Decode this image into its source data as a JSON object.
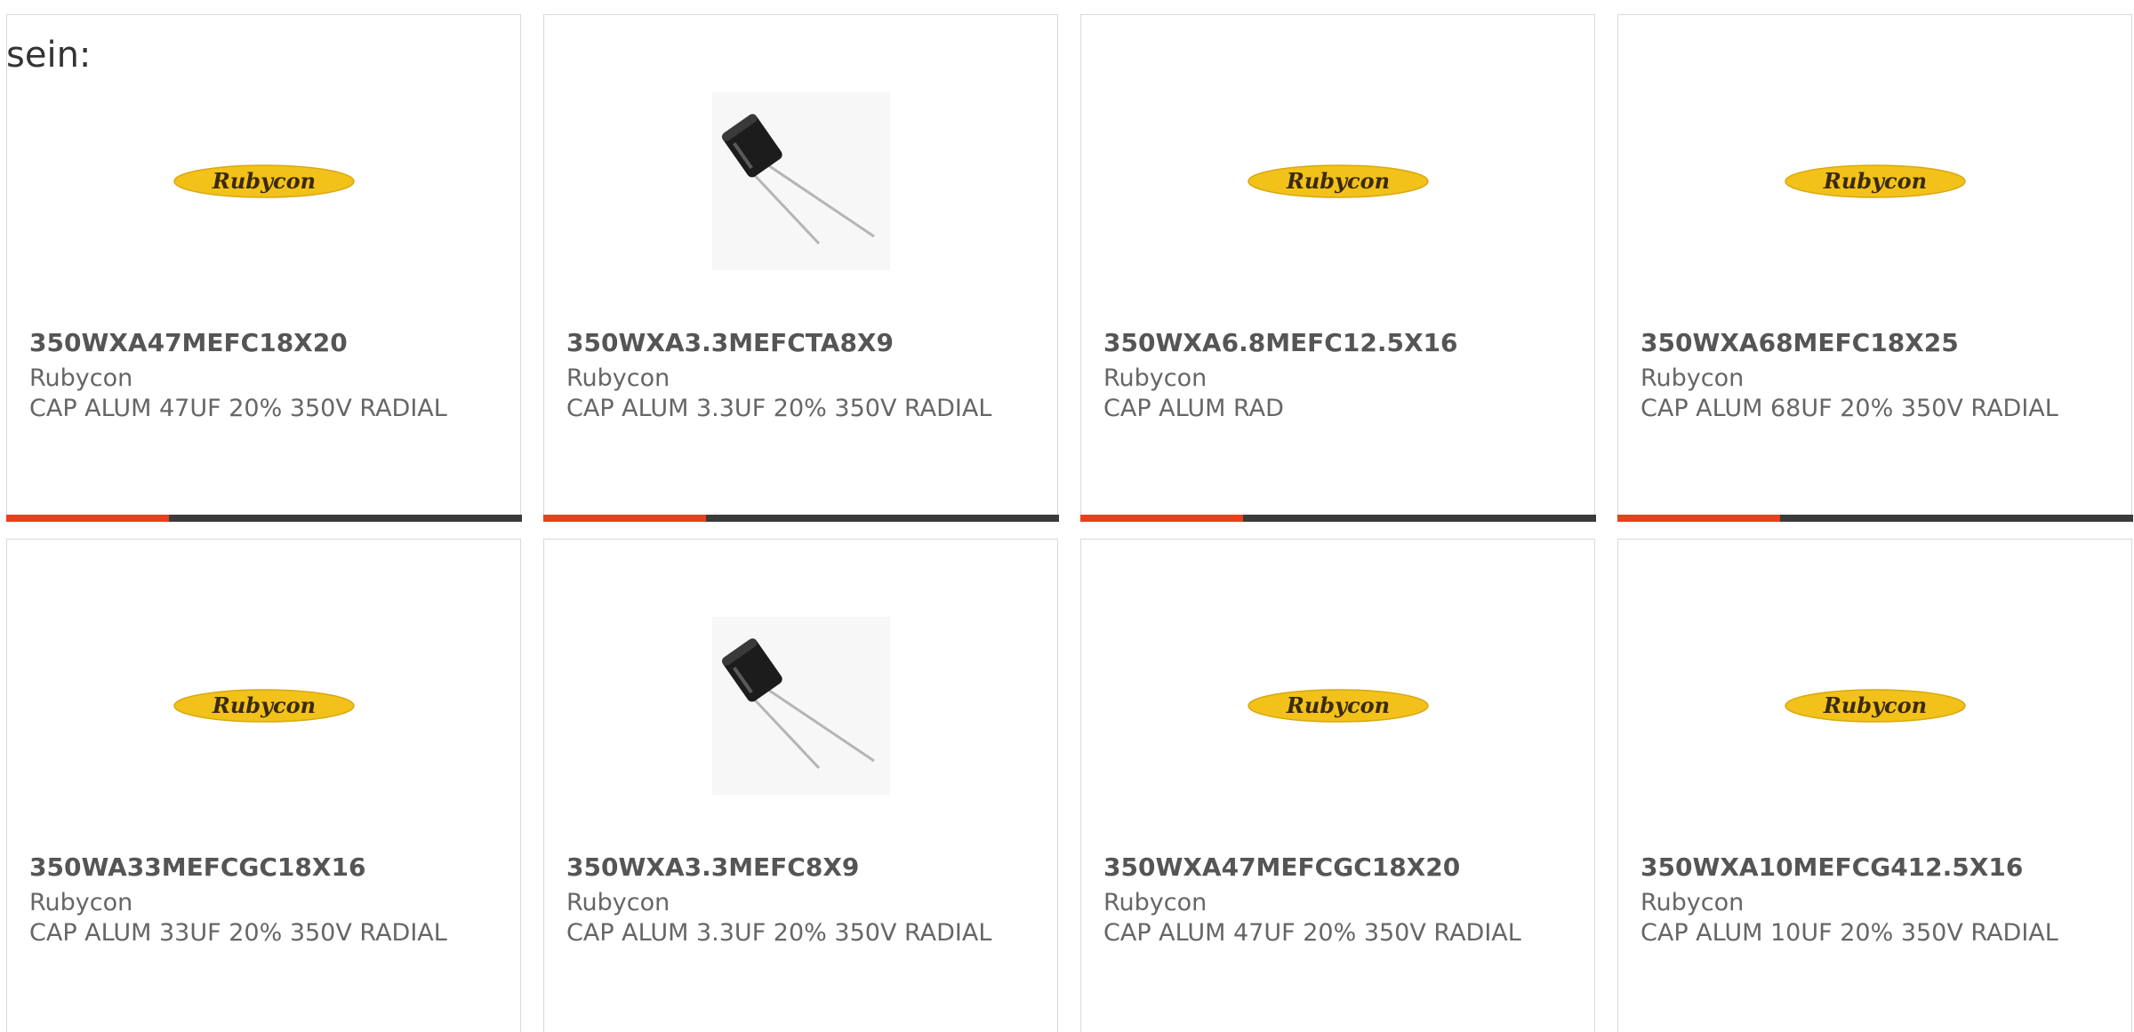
{
  "lead_text": "sein:",
  "products": [
    {
      "part": "350WXA47MEFC18X20",
      "maker": "Rubycon",
      "description": "CAP ALUM 47UF 20% 350V RADIAL",
      "image": "rubycon-logo"
    },
    {
      "part": "350WXA3.3MEFCTA8X9",
      "maker": "Rubycon",
      "description": "CAP ALUM 3.3UF 20% 350V RADIAL",
      "image": "capacitor-photo"
    },
    {
      "part": "350WXA6.8MEFC12.5X16",
      "maker": "Rubycon",
      "description": "CAP ALUM RAD",
      "image": "rubycon-logo"
    },
    {
      "part": "350WXA68MEFC18X25",
      "maker": "Rubycon",
      "description": "CAP ALUM 68UF 20% 350V RADIAL",
      "image": "rubycon-logo"
    },
    {
      "part": "350WA33MEFCGC18X16",
      "maker": "Rubycon",
      "description": "CAP ALUM 33UF 20% 350V RADIAL",
      "image": "rubycon-logo"
    },
    {
      "part": "350WXA3.3MEFC8X9",
      "maker": "Rubycon",
      "description": "CAP ALUM 3.3UF 20% 350V RADIAL",
      "image": "capacitor-photo"
    },
    {
      "part": "350WXA47MEFCGC18X20",
      "maker": "Rubycon",
      "description": "CAP ALUM 47UF 20% 350V RADIAL",
      "image": "rubycon-logo"
    },
    {
      "part": "350WXA10MEFCG412.5X16",
      "maker": "Rubycon",
      "description": "CAP ALUM 10UF 20% 350V RADIAL",
      "image": "rubycon-logo"
    }
  ],
  "logo_text": "Rubycon",
  "colors": {
    "accent": "#e8401c",
    "bar": "#3b3b3b",
    "logo_fill": "#f2c21a",
    "logo_text": "#3a2a10"
  }
}
